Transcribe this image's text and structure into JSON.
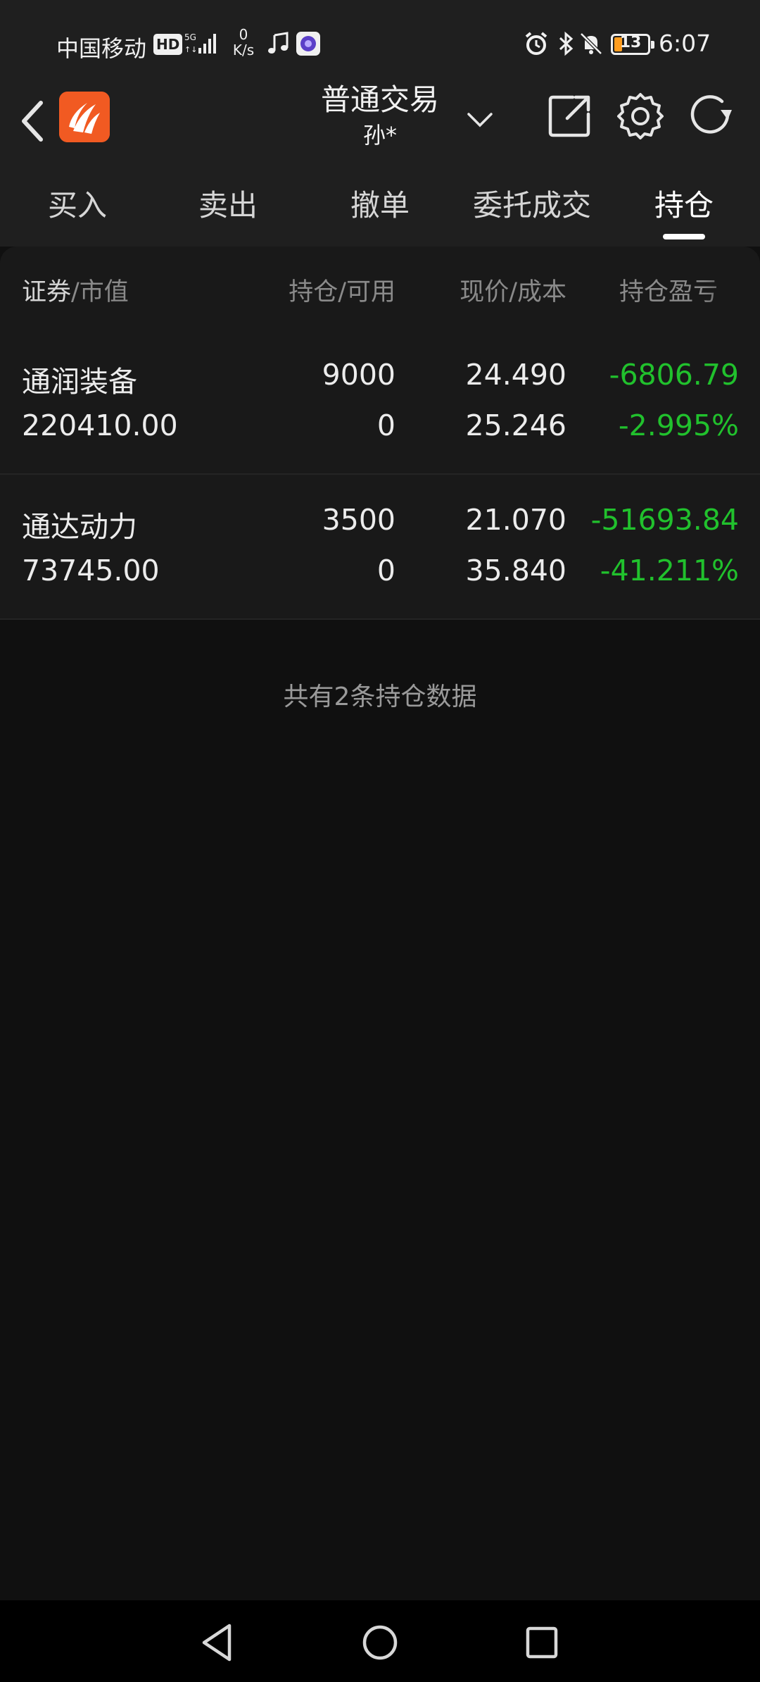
{
  "status_bar": {
    "carrier": "中国移动",
    "hd_badge": "HD",
    "network": "5G",
    "speed_value": "0",
    "speed_unit": "K/s",
    "battery": "13",
    "time": "6:07",
    "icons": [
      "music-note-icon",
      "app-icon",
      "alarm-icon",
      "bluetooth-icon",
      "mute-icon"
    ]
  },
  "header": {
    "title": "普通交易",
    "subtitle": "孙*",
    "icons": [
      "back-chevron-icon",
      "broker-logo",
      "dropdown-chevron-icon",
      "share-icon",
      "settings-gear-icon",
      "refresh-icon"
    ]
  },
  "tabs": [
    {
      "label": "买入",
      "active": false
    },
    {
      "label": "卖出",
      "active": false
    },
    {
      "label": "撤单",
      "active": false
    },
    {
      "label": "委托成交",
      "active": false
    },
    {
      "label": "持仓",
      "active": true
    }
  ],
  "table": {
    "headers": {
      "col1_strong": "证券",
      "col1_rest": "/市值",
      "col2": "持仓/可用",
      "col3": "现价/成本",
      "col4": "持仓盈亏"
    },
    "rows": [
      {
        "name": "通润装备",
        "market_value": "220410.00",
        "position": "9000",
        "available": "0",
        "price": "24.490",
        "cost": "25.246",
        "pnl": "-6806.79",
        "pnl_pct": "-2.995%"
      },
      {
        "name": "通达动力",
        "market_value": "73745.00",
        "position": "3500",
        "available": "0",
        "price": "21.070",
        "cost": "35.840",
        "pnl": "-51693.84",
        "pnl_pct": "-41.211%"
      }
    ]
  },
  "summary": "共有2条持仓数据",
  "colors": {
    "background": "#101010",
    "header_bg": "#1f1f1f",
    "row_bg": "#191919",
    "loss_green": "#21c12d",
    "logo_orange": "#f15a22"
  },
  "nav_bar": {
    "icons": [
      "back-triangle-icon",
      "home-circle-icon",
      "recents-square-icon"
    ]
  }
}
